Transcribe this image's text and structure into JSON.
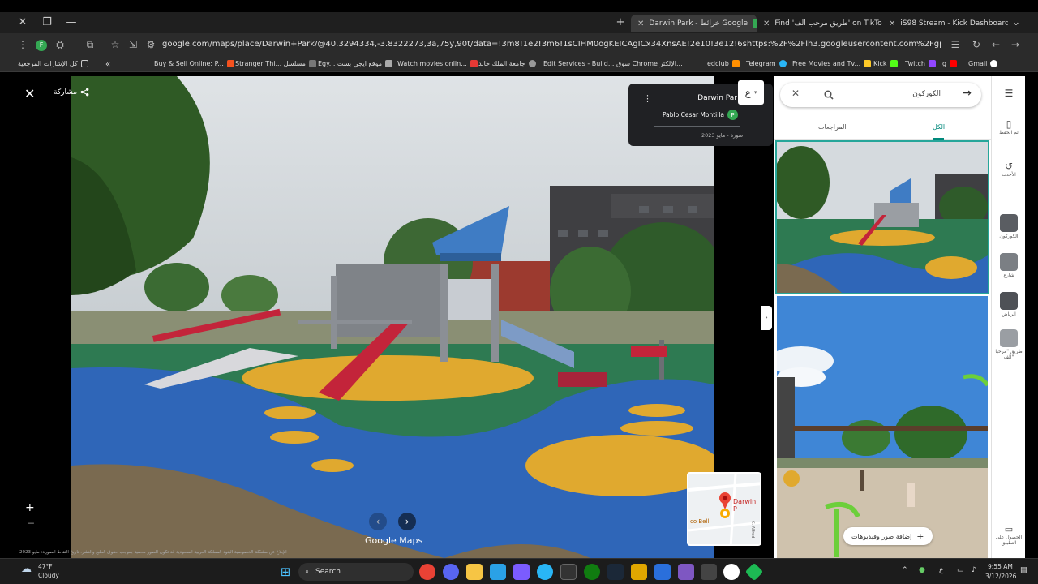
{
  "browser": {
    "tabs": [
      {
        "title": "Darwin Park - خرائط Google",
        "active": true,
        "favicon_color": "#34a853"
      },
      {
        "title": "Find 'طريق مرحب الف' on TikTok",
        "active": false,
        "favicon_color": "#000000"
      },
      {
        "title": "iS98 Stream - Kick Dashboard",
        "active": false,
        "favicon_color": "#53fc18"
      }
    ],
    "new_tab_label": "+",
    "url": "google.com/maps/place/Darwin+Park/@40.3294334,-3.8322273,3a,75y,90t/data=!3m8!1e2!3m6!1sCIHM0ogKEICAgICx34XnsAE!2e10!3e12!6shttps:%2F%2Flh3.googleusercontent.com%2Fgps-cs-s%2FAHVAwepHnvbwUWRioQ4bTMZU5h...",
    "profile_initial": "F",
    "bookmarks": [
      {
        "label": "Buy & Sell Online: P...",
        "color": "#f4511e"
      },
      {
        "label": "Stranger Thi... مسلسل",
        "color": "#777777"
      },
      {
        "label": "Egy... موقع ايجي بست",
        "color": "#aaaaaa"
      },
      {
        "label": "Watch movies onlin...",
        "color": "#e53935"
      },
      {
        "label": "جامعة الملك خالد",
        "color": "#999999"
      },
      {
        "label": "Edit Services - Build...",
        "color": "#bbbbbb"
      },
      {
        "label": "سوق Chrome الإلكتر...",
        "color": "#4285f4"
      },
      {
        "label": "edclub",
        "color": "#ff8f00"
      },
      {
        "label": "Telegram",
        "color": "#29b6f6"
      },
      {
        "label": "Free Movies and Tv...",
        "color": "#ffca28"
      },
      {
        "label": "Kick",
        "color": "#53fc18"
      },
      {
        "label": "Twitch",
        "color": "#9146ff"
      },
      {
        "label": "g",
        "color": "#ff0000"
      },
      {
        "label": "Gmail",
        "color": "#ea4335"
      }
    ],
    "bookmarks_overflow": "«",
    "all_bookmarks": "كل الإشارات المرجعية"
  },
  "viewer": {
    "close_label": "✕",
    "share_label": "مشاركة",
    "attribution": {
      "place": "Darwin Par",
      "author": "Pablo Cesar Montilla",
      "author_initial": "P",
      "date": "صورة - مايو 2023"
    },
    "lang_label": "ع",
    "minimap": {
      "place": "Darwin P",
      "poi": "co Bell",
      "street": "C. Alfred"
    },
    "brand": "Google Maps",
    "footer": "الإبلاغ عن مشكلة   الخصوصية   البنود   المملكة العربية السعودية   قد تكون الصور محمية بموجب حقوق الطبع والنشر.   تاريخ التقاط الصورة: مايو 2023"
  },
  "panel": {
    "search_value": "الكوركون",
    "tab_all": "الكل",
    "tab_reviews": "المراجعات",
    "add_photos_label": "إضافة صور وفيديوهات"
  },
  "rail": {
    "saved": "تم الحفظ",
    "recent": "الأحدث",
    "items": [
      "الكوركون",
      "شارع",
      "الرياض",
      "طريق \"مرحبا الف\""
    ],
    "get_app": "الحصول على التطبيق"
  },
  "taskbar": {
    "weather_temp": "47°F",
    "weather_desc": "Cloudy",
    "search_label": "Search",
    "lang": "ع",
    "time": "9:55 AM",
    "date": "3/12/2026"
  },
  "colors": {
    "accent_teal": "#00897b",
    "chrome_dark": "#1f1f1f",
    "maps_red": "#ea4335"
  }
}
